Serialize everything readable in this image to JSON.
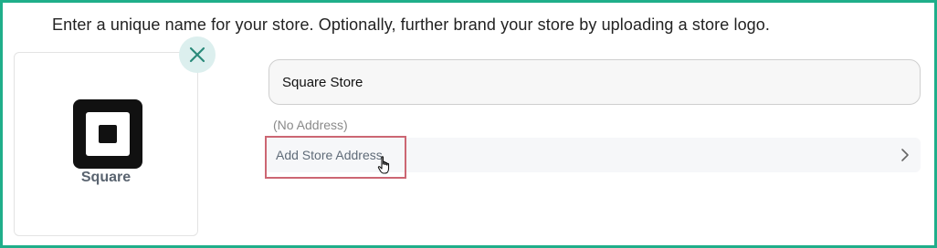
{
  "intro": {
    "text": "Enter a unique name for your store. Optionally, further brand your store by uploading a store logo."
  },
  "logo": {
    "brand_name": "Square",
    "icon": "square-logo-icon"
  },
  "remove_logo": {
    "icon": "close-icon",
    "color": "#2a8a7a"
  },
  "store_name": {
    "value": "Square Store"
  },
  "address": {
    "status": "(No Address)",
    "add_label": "Add Store Address",
    "icon": "chevron-right-icon"
  },
  "colors": {
    "frame_border": "#1fae8a",
    "highlight": "#cc6673"
  }
}
